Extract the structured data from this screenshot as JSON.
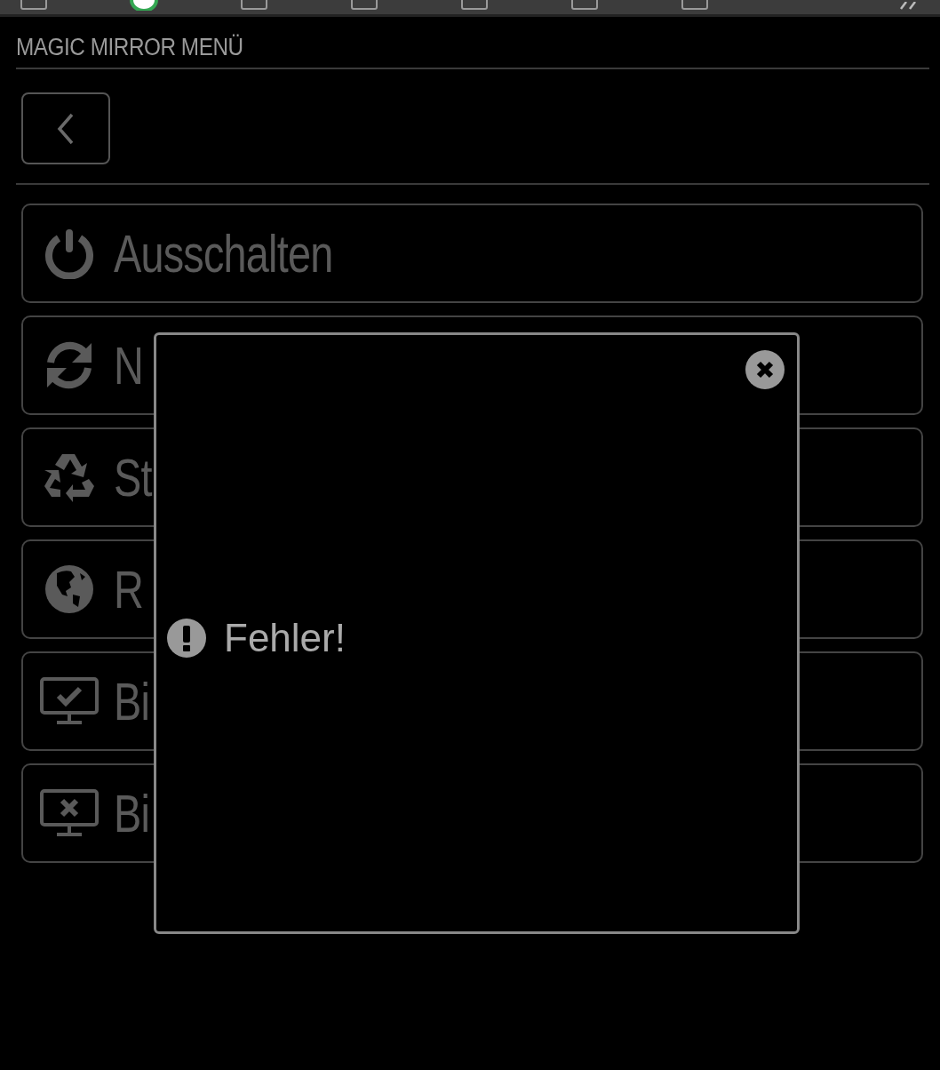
{
  "bookmarks_bar": {
    "items": [
      {
        "kind": "folder"
      },
      {
        "kind": "site"
      },
      {
        "kind": "folder"
      },
      {
        "kind": "folder"
      },
      {
        "kind": "folder"
      },
      {
        "kind": "folder"
      },
      {
        "kind": "folder"
      }
    ]
  },
  "header": {
    "title": "MAGIC MIRROR MENÜ"
  },
  "menu": {
    "items": [
      {
        "kind": "power",
        "label": "Ausschalten"
      },
      {
        "kind": "refresh",
        "label": "N"
      },
      {
        "kind": "recycle",
        "label": "St"
      },
      {
        "kind": "globe",
        "label": "R"
      },
      {
        "kind": "monitor-check",
        "label": "Bi"
      },
      {
        "kind": "monitor-x",
        "label": "Bi"
      }
    ]
  },
  "dialog": {
    "message": "Fehler!"
  }
}
